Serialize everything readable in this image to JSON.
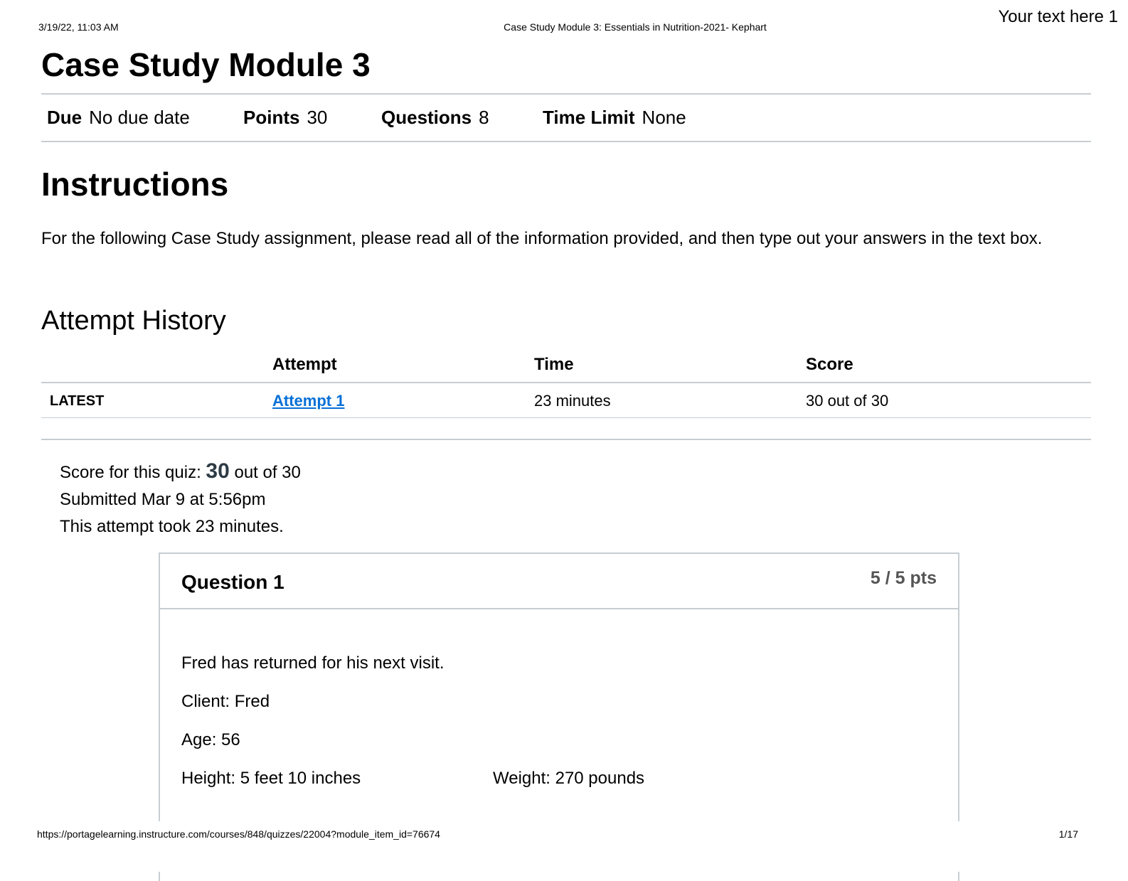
{
  "print_header": {
    "datetime": "3/19/22, 11:03 AM",
    "doc_title": "Case Study Module 3: Essentials in Nutrition-2021- Kephart",
    "watermark": "Your text here 1"
  },
  "quiz": {
    "title": "Case Study Module 3",
    "meta": [
      {
        "label": "Due",
        "value": "No due date"
      },
      {
        "label": "Points",
        "value": "30"
      },
      {
        "label": "Questions",
        "value": "8"
      },
      {
        "label": "Time Limit",
        "value": "None"
      }
    ]
  },
  "instructions": {
    "heading": "Instructions",
    "text": "For the following Case Study assignment, please read all of the information provided, and then type out your answers in the text box."
  },
  "attempt_history": {
    "heading": "Attempt History",
    "columns": [
      "",
      "Attempt",
      "Time",
      "Score"
    ],
    "rows": [
      {
        "label": "LATEST",
        "attempt": "Attempt 1 ",
        "time": "23 minutes",
        "score": "30 out of 30"
      }
    ]
  },
  "summary": {
    "score_prefix": "Score for this quiz: ",
    "score_value": "30",
    "score_suffix": " out of 30",
    "submitted": "Submitted Mar 9 at 5:56pm",
    "duration": "This attempt took 23 minutes."
  },
  "question": {
    "title": "Question 1",
    "points": "5 / 5 pts",
    "lines": [
      "Fred has returned for his next visit.",
      "Client: Fred",
      "Age: 56",
      "Height: 5 feet 10 inches",
      "Weight: 270 pounds"
    ]
  },
  "print_footer": {
    "url": "https://portagelearning.instructure.com/courses/848/quizzes/22004?module_item_id=76674",
    "page": "1/17"
  }
}
